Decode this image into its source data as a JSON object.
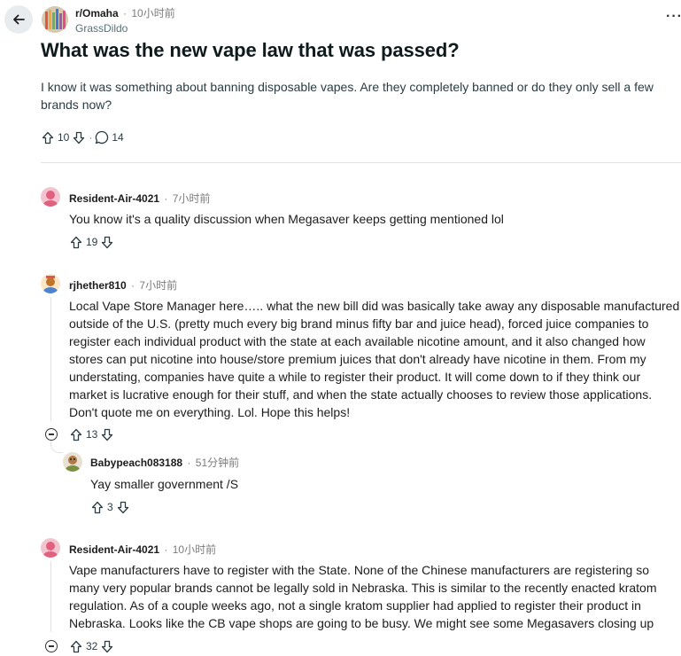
{
  "post": {
    "subreddit": "r/Omaha",
    "time": "10小时前",
    "author": "GrassDildo",
    "title": "What was the new vape law that was passed?",
    "body": "I know it was something about banning disposable vapes. Are they completely banned or do they only sell a few brands now?",
    "upvotes": "10",
    "comments": "14"
  },
  "comments": [
    {
      "user": "Resident-Air-4021",
      "time": "7小时前",
      "body": "You know it's a quality discussion when Megasaver keeps getting mentioned lol",
      "score": "19"
    },
    {
      "user": "rjhether810",
      "time": "7小时前",
      "body": "Local Vape Store Manager here….. what the new bill did was basically take away any disposable manufactured outside of the U.S. (pretty much every big brand minus fifty bar and juice head), forced juice companies to register each individual product with the state at each available nicotine amount, and it also changed how stores can put nicotine into house/store premium juices that don't already have nicotine in them. From my understating, companies have quite a while to register their product. It will come down to if they think our market is lucrative enough for their stuff, and when the state actually chooses to review those applications. Don't quote me on everything. Lol. Hope this helps!",
      "score": "13"
    },
    {
      "user": "Babypeach083188",
      "time": "51分钟前",
      "body": "Yay smaller government /S",
      "score": "3"
    },
    {
      "user": "Resident-Air-4021",
      "time": "10小时前",
      "body": "Vape manufacturers have to register with the State. None of the Chinese manufacturers are registering so many very popular brands cannot be legally sold in Nebraska. This is similar to the recently enacted kratom regulation. As of a couple weeks ago, not a single kratom supplier had applied to register their product in Nebraska. Looks like the CB vape shops are going to be busy. We might see some Megasavers closing up",
      "score": "32"
    }
  ],
  "ui": {
    "separator": "·",
    "more": "···"
  },
  "icons": {
    "back": "arrow-left-icon",
    "upvote": "arrow-up-icon",
    "downvote": "arrow-down-icon",
    "comment": "speech-bubble-icon",
    "collapse": "minus-circle-icon"
  },
  "colors": {
    "text": "#1c1c1c",
    "meta": "#7c7c7c",
    "divider": "#e0e3e5",
    "back_bg": "#e9ecef"
  }
}
